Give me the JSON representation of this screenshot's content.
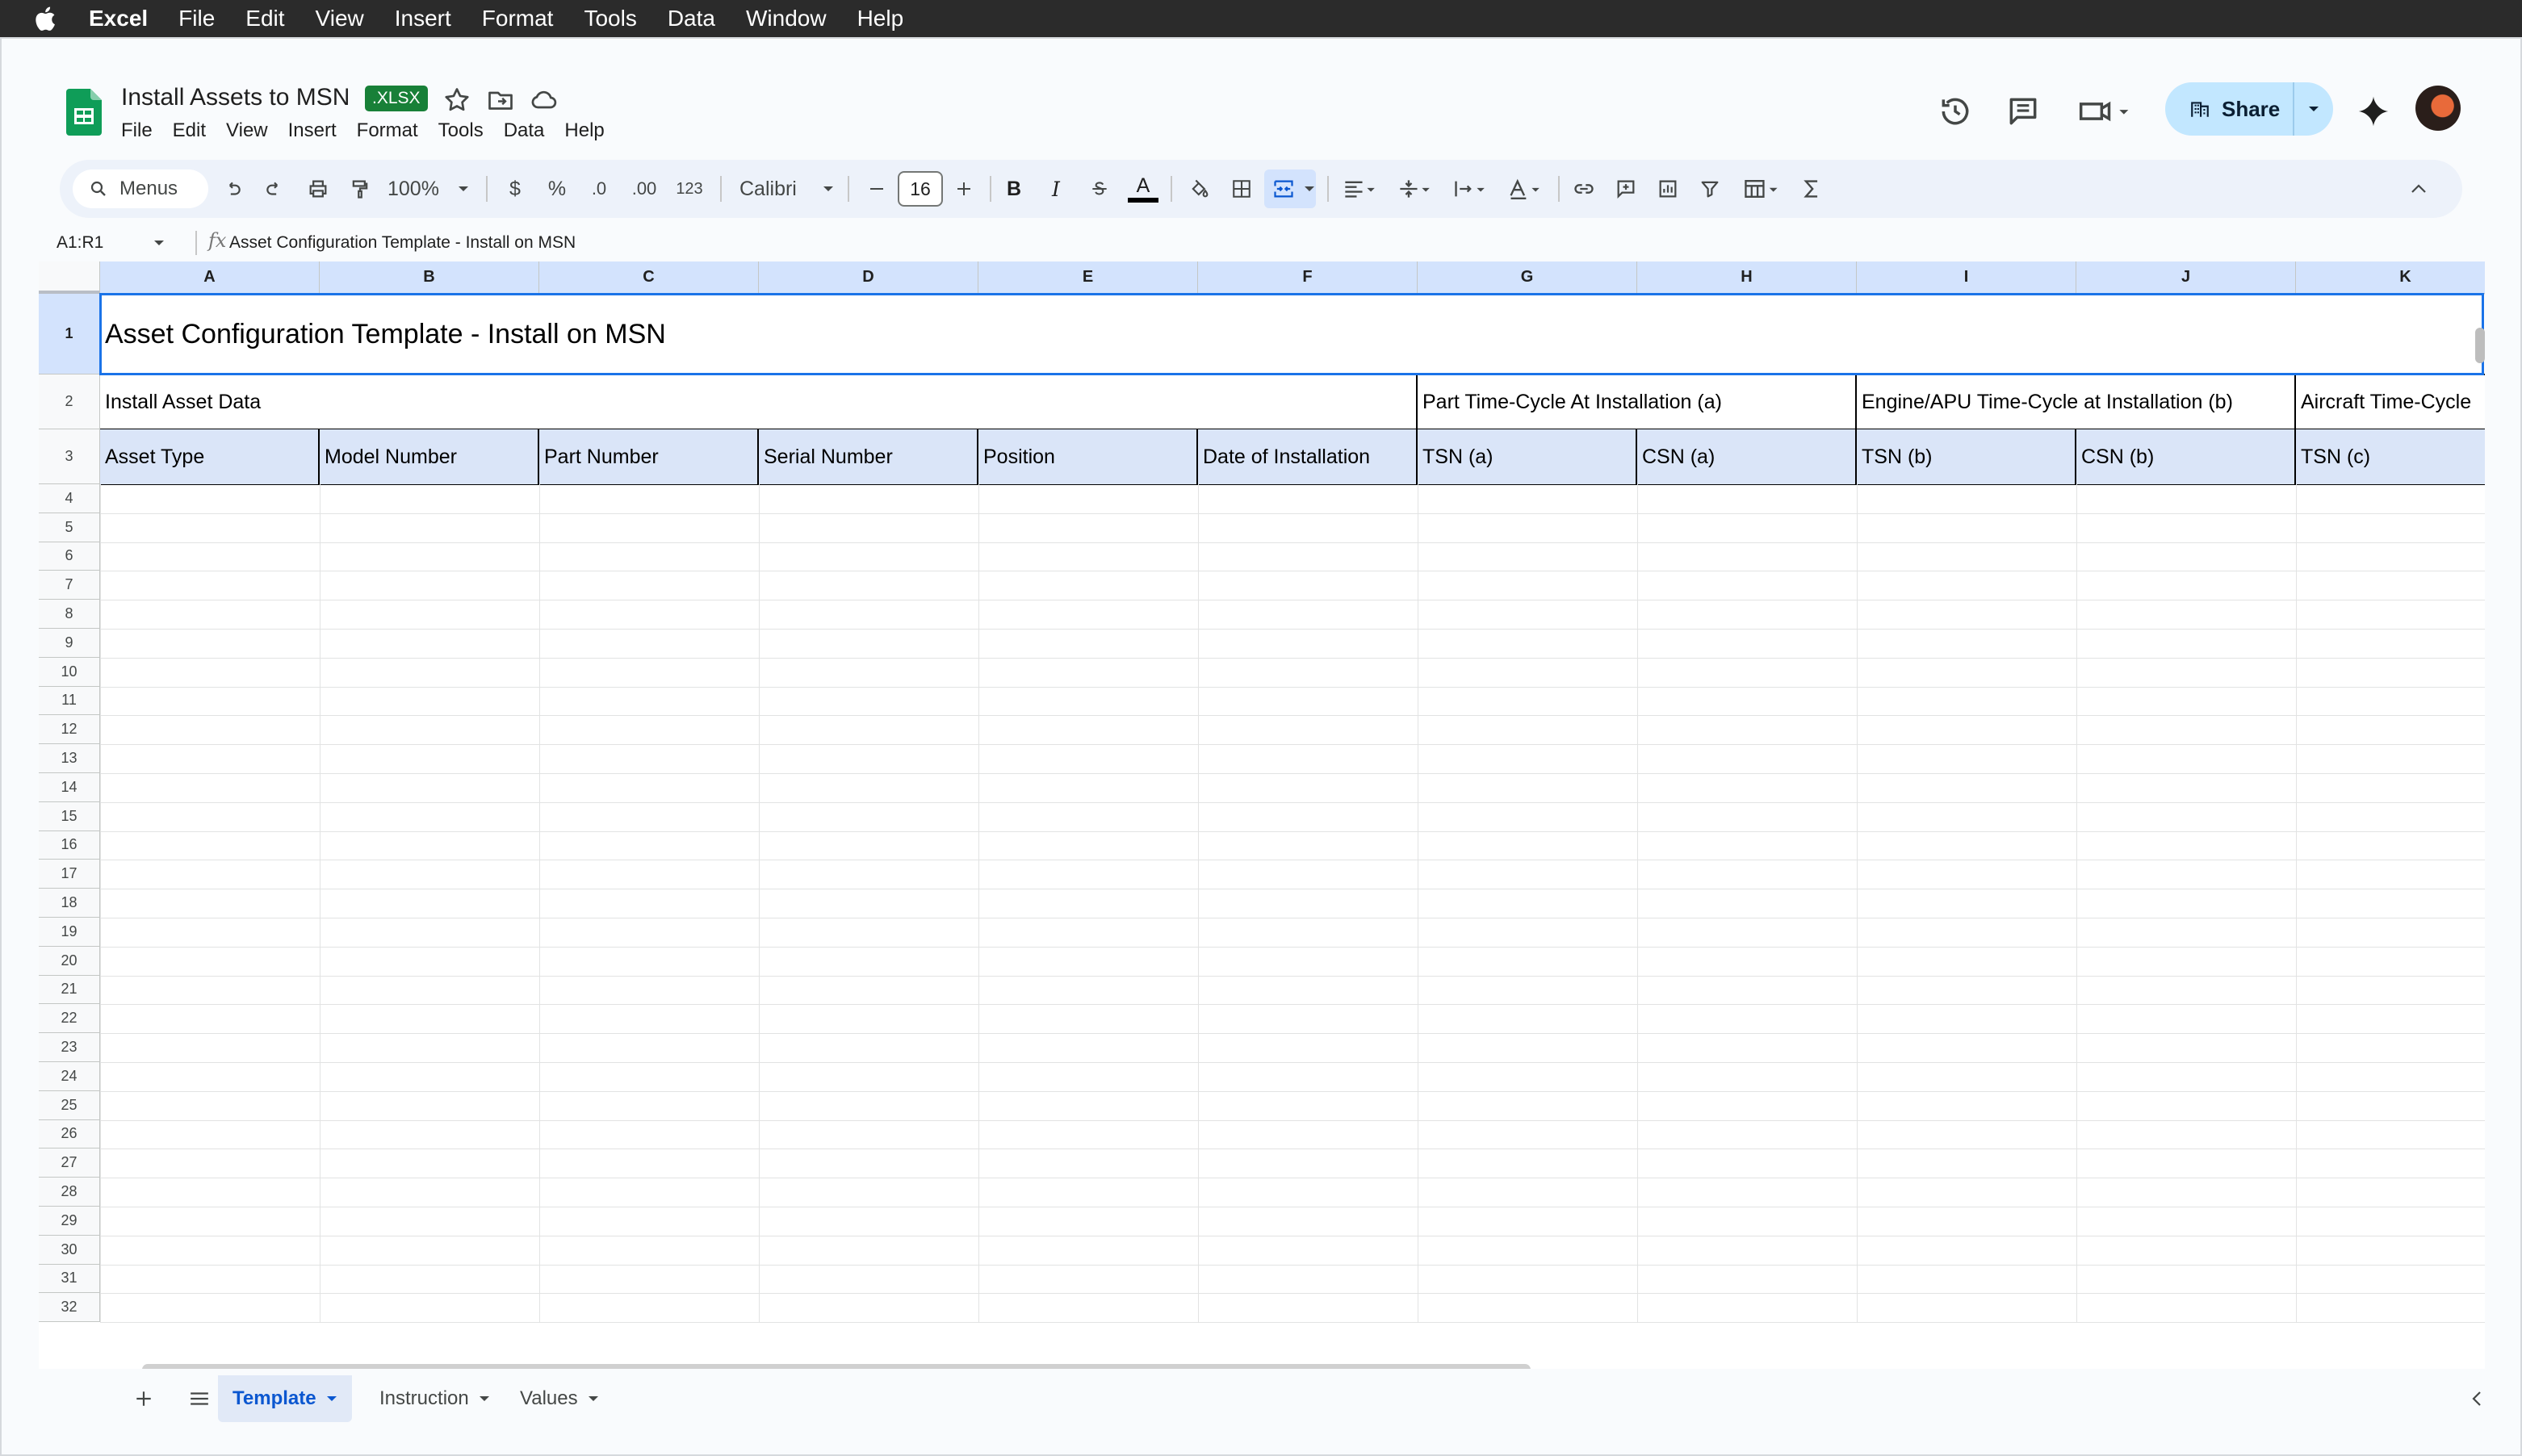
{
  "os_menubar": {
    "app_name": "Excel",
    "items": [
      "File",
      "Edit",
      "View",
      "Insert",
      "Format",
      "Tools",
      "Data",
      "Window",
      "Help"
    ]
  },
  "document": {
    "title": "Install Assets to MSN",
    "badge": ".XLSX",
    "menu": [
      "File",
      "Edit",
      "View",
      "Insert",
      "Format",
      "Tools",
      "Data",
      "Help"
    ]
  },
  "header_actions": {
    "share_label": "Share"
  },
  "toolbar": {
    "menus_label": "Menus",
    "zoom": "100%",
    "currency": "$",
    "percent": "%",
    "decrease_decimal": ".0",
    "increase_decimal": ".00",
    "number_format": "123",
    "font_name": "Calibri",
    "font_size": "16",
    "bold": "B",
    "italic": "I",
    "text_color": "A"
  },
  "formula_bar": {
    "name_box": "A1:R1",
    "fx": "fx",
    "content": "Asset Configuration Template - Install on MSN"
  },
  "grid": {
    "columns": [
      "A",
      "B",
      "C",
      "D",
      "E",
      "F",
      "G",
      "H",
      "I",
      "J",
      "K"
    ],
    "row_numbers": [
      "1",
      "2",
      "3",
      "4",
      "5",
      "6",
      "7",
      "8",
      "9",
      "10",
      "11",
      "12",
      "13",
      "14",
      "15",
      "16",
      "17",
      "18",
      "19",
      "20",
      "21",
      "22",
      "23",
      "24",
      "25",
      "26",
      "27",
      "28",
      "29",
      "30",
      "31",
      "32"
    ],
    "title_cell": "Asset Configuration Template - Install on MSN",
    "group_headers": {
      "install_asset_data": "Install Asset Data",
      "part_time_cycle": "Part Time-Cycle At Installation (a)",
      "engine_apu_time_cycle": "Engine/APU Time-Cycle at Installation (b)",
      "aircraft_time_cycle": "Aircraft Time-Cycle"
    },
    "field_headers": [
      "Asset Type",
      "Model Number",
      "Part Number",
      "Serial Number",
      "Position",
      "Date of Installation",
      "TSN (a)",
      "CSN (a)",
      "TSN (b)",
      "CSN (b)",
      "TSN (c)"
    ]
  },
  "sheet_tabs": {
    "tabs": [
      "Template",
      "Instruction",
      "Values"
    ],
    "active": "Template"
  },
  "colors": {
    "share_bg": "#c2e7ff",
    "selection": "#1a73e8",
    "header_fill": "#dae5f8",
    "xlsx_green": "#188038"
  }
}
